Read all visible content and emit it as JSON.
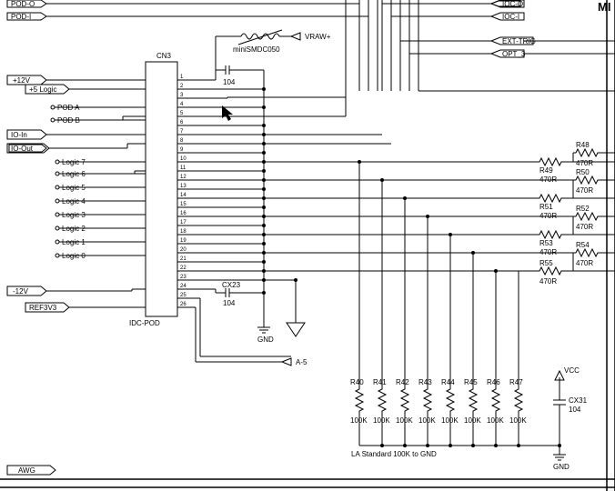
{
  "ports": {
    "pod_o": "POD-O",
    "pod_i": "POD-I",
    "plus12v": "+12V",
    "plus5logic": "+5 Logic",
    "pod_a": "POD A",
    "pod_b": "POD B",
    "io_in": "IO-In",
    "io_out": "IO-Out",
    "logic7": "Logic 7",
    "logic6": "Logic 6",
    "logic5": "Logic 5",
    "logic4": "Logic 4",
    "logic3": "Logic 3",
    "logic2": "Logic 2",
    "logic1": "Logic 1",
    "logic0": "Logic 0",
    "minus12v": "-12V",
    "ref3v3": "REF3V3",
    "awg": "AWG",
    "ioc_o": "IOC-O",
    "ioc_i": "IOC-I",
    "ext_trig": "EXT-TRIG",
    "opt_3": "OPT_3",
    "vraw": "VRAW+",
    "a5": "A-5",
    "vcc": "VCC",
    "gnd1": "GND",
    "gnd2": "GND"
  },
  "connector": {
    "ref": "CN3",
    "type": "IDC-POD",
    "pins": [
      "1",
      "2",
      "3",
      "4",
      "5",
      "6",
      "7",
      "8",
      "9",
      "10",
      "11",
      "12",
      "13",
      "14",
      "15",
      "16",
      "17",
      "18",
      "19",
      "20",
      "21",
      "22",
      "23",
      "24",
      "25",
      "26"
    ]
  },
  "components": {
    "ptc": "miniSMDC050",
    "c_top": {
      "ref": "",
      "val": "104"
    },
    "cx23": {
      "ref": "CX23",
      "val": "104"
    },
    "cx31": {
      "ref": "CX31",
      "val": "104"
    }
  },
  "pulldowns": {
    "r40": {
      "ref": "R40",
      "val": "100K"
    },
    "r41": {
      "ref": "R41",
      "val": "100K"
    },
    "r42": {
      "ref": "R42",
      "val": "100K"
    },
    "r43": {
      "ref": "R43",
      "val": "100K"
    },
    "r44": {
      "ref": "R44",
      "val": "100K"
    },
    "r45": {
      "ref": "R45",
      "val": "100K"
    },
    "r46": {
      "ref": "R46",
      "val": "100K"
    },
    "r47": {
      "ref": "R47",
      "val": "100K"
    },
    "note": "LA Standard 100K to GND"
  },
  "series_res": {
    "r48": {
      "ref": "R48",
      "val": "470R"
    },
    "r49": {
      "ref": "R49",
      "val": "470R"
    },
    "r50": {
      "ref": "R50",
      "val": "470R"
    },
    "r51": {
      "ref": "R51",
      "val": "470R"
    },
    "r52": {
      "ref": "R52",
      "val": "470R"
    },
    "r53": {
      "ref": "R53",
      "val": "470R"
    },
    "r54": {
      "ref": "R54",
      "val": "470R"
    },
    "r55": {
      "ref": "R55",
      "val": "470R"
    }
  },
  "title_fragment": "MI"
}
